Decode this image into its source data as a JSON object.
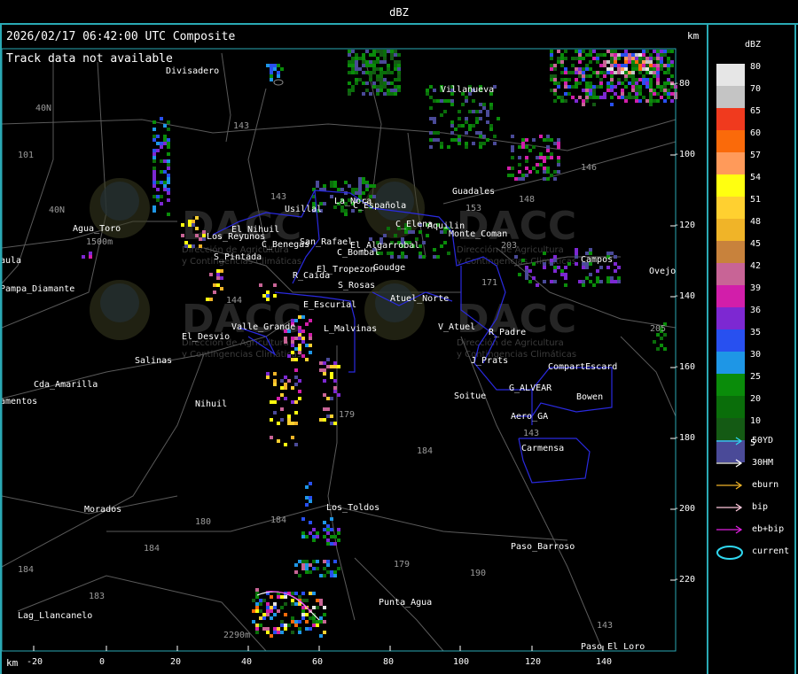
{
  "window": {
    "title": "dBZ"
  },
  "header": {
    "timestamp": "2026/02/17 06:42:00 UTC Composite",
    "track_status": "Track data not available",
    "km_unit_right": "km",
    "km_unit_bottom": "km"
  },
  "colorbar": {
    "title": "dBZ",
    "levels": [
      {
        "label": "80",
        "color": "#e6e6e6"
      },
      {
        "label": "70",
        "color": "#c4c4c4"
      },
      {
        "label": "65",
        "color": "#f03a1e"
      },
      {
        "label": "60",
        "color": "#fa6a0a"
      },
      {
        "label": "57",
        "color": "#ff9a5a"
      },
      {
        "label": "54",
        "color": "#ffff10"
      },
      {
        "label": "51",
        "color": "#ffd030"
      },
      {
        "label": "48",
        "color": "#f0b428"
      },
      {
        "label": "45",
        "color": "#c8823c"
      },
      {
        "label": "42",
        "color": "#c86496"
      },
      {
        "label": "39",
        "color": "#d21eaa"
      },
      {
        "label": "36",
        "color": "#7d28d2"
      },
      {
        "label": "35",
        "color": "#2850f0"
      },
      {
        "label": "30",
        "color": "#1e96e6"
      },
      {
        "label": "25",
        "color": "#0a8c0a"
      },
      {
        "label": "20",
        "color": "#0a6e0a"
      },
      {
        "label": "10",
        "color": "#145a14"
      },
      {
        "label": "5",
        "color": "#4a4a98"
      }
    ]
  },
  "track_legend": [
    {
      "label": "50YD",
      "color": "#30d8f0"
    },
    {
      "label": "30HM",
      "color": "#ffffff"
    },
    {
      "label": "eburn",
      "color": "#f0b428"
    },
    {
      "label": "bip",
      "color": "#ffc8dc"
    },
    {
      "label": "eb+bip",
      "color": "#e020e0"
    },
    {
      "label": "current",
      "color": "#30d8f0"
    }
  ],
  "axes": {
    "y_ticks": [
      "-80",
      "-100",
      "-120",
      "-140",
      "-160",
      "-180",
      "-200",
      "-220"
    ],
    "x_ticks": [
      "-20",
      "0",
      "20",
      "40",
      "60",
      "80",
      "100",
      "120",
      "140"
    ]
  },
  "places": [
    {
      "name": "Divisadero"
    },
    {
      "name": "Villanueva"
    },
    {
      "name": "Guadales"
    },
    {
      "name": "Monte_Coman"
    },
    {
      "name": "Usillal"
    },
    {
      "name": "C_Española"
    },
    {
      "name": "C_Elena"
    },
    {
      "name": "Aquilin"
    },
    {
      "name": "La_Nora"
    },
    {
      "name": "San_Rafael"
    },
    {
      "name": "C_Benegas"
    },
    {
      "name": "El_Algarrobal"
    },
    {
      "name": "C_Bombal"
    },
    {
      "name": "El_Tropezon"
    },
    {
      "name": "Goudge"
    },
    {
      "name": "Agua_Toro"
    },
    {
      "name": "Los_Reyunos"
    },
    {
      "name": "El_Nihuil"
    },
    {
      "name": "S_Pintada"
    },
    {
      "name": "R_Caida"
    },
    {
      "name": "S_Rosas"
    },
    {
      "name": "Atuel_Norte"
    },
    {
      "name": "E_Escurial"
    },
    {
      "name": "Valle_Grande"
    },
    {
      "name": "L_Malvinas"
    },
    {
      "name": "V_Atuel"
    },
    {
      "name": "El_Desvio"
    },
    {
      "name": "R_Padre"
    },
    {
      "name": "J_Prats"
    },
    {
      "name": "CompartEscard"
    },
    {
      "name": "Salinas"
    },
    {
      "name": "Cda_Amarilla"
    },
    {
      "name": "Nihuil"
    },
    {
      "name": "Soitue"
    },
    {
      "name": "G_ALVEAR"
    },
    {
      "name": "Bowen"
    },
    {
      "name": "Aero_GA"
    },
    {
      "name": "Carmensa"
    },
    {
      "name": "Morados"
    },
    {
      "name": "Los_Toldos"
    },
    {
      "name": "Paso_Barroso"
    },
    {
      "name": "Punta_Agua"
    },
    {
      "name": "Lag_Llancanelo"
    },
    {
      "name": "Paso_El_Loro"
    },
    {
      "name": "Pampa_Diamante"
    },
    {
      "name": "Campos"
    },
    {
      "name": "Ovejo"
    },
    {
      "name": "aula"
    },
    {
      "name": "amentos"
    }
  ],
  "watermark": {
    "brand": "DACC",
    "subtitle_1": "Dirección de Agricultura",
    "subtitle_2": "y Contingencias Climáticas"
  }
}
